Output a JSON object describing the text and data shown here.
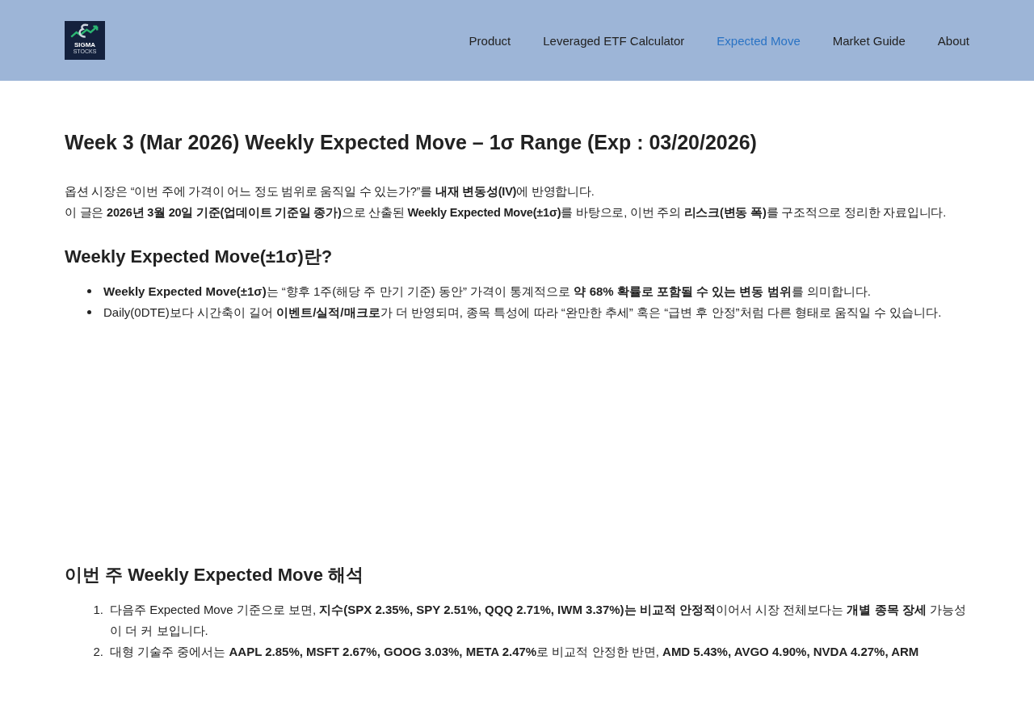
{
  "header": {
    "logo": {
      "text": "SIGMA",
      "subtext": "STOCKS"
    },
    "nav": [
      {
        "label": "Product",
        "selected": false
      },
      {
        "label": "Leveraged ETF Calculator",
        "selected": false
      },
      {
        "label": "Expected Move",
        "selected": true
      },
      {
        "label": "Market Guide",
        "selected": false
      },
      {
        "label": "About",
        "selected": false
      }
    ]
  },
  "title": "Week 3 (Mar 2026) Weekly Expected Move – 1σ Range (Exp : 03/20/2026)",
  "intro": [
    "옵션 시장은 “이번 주에 가격이 어느 정도 범위로 움직일 수 있는가?”를 **내재 변동성(IV)**에 반영합니다.",
    "이 글은 **2026년 3월 20일 기준(업데이트 기준일 종가)**으로 산출된 **Weekly Expected Move(±1σ)**를 바탕으로, 이번 주의 **리스크(변동 폭)**를 구조적으로 정리한 자료입니다."
  ],
  "section_1": {
    "heading": "Weekly Expected Move(±1σ)란?",
    "bullets": [
      "**Weekly Expected Move(±1σ)**는 “향후 1주(해당 주 만기 기준) 동안” 가격이 통계적으로 **약 68% 확률로 포함될 수 있는 변동 범위**를 의미합니다.",
      "Daily(0DTE)보다 시간축이 길어 **이벤트/실적/매크로**가 더 반영되며, 종목 특성에 따라 “완만한 추세” 혹은 “급변 후 안정”처럼 다른 형태로 움직일 수 있습니다."
    ]
  },
  "section_2": {
    "heading": "이번 주 Weekly Expected Move 해석",
    "items": [
      {
        "number": "1.",
        "text": "다음주 Expected Move 기준으로 보면, **지수(SPX 2.35%, SPY 2.51%, QQQ 2.71%, IWM 3.37%)는 비교적 안정적**이어서 시장 전체보다는 **개별 종목 장세** 가능성이 더 커 보입니다."
      },
      {
        "number": "2.",
        "text": "대형 기술주 중에서는 **AAPL 2.85%, MSFT 2.67%, GOOG 3.03%, META 2.47%**로 비교적 안정한 반면, **AMD 5.43%, AVGO 4.90%, NVDA 4.27%, ARM**"
      }
    ]
  }
}
